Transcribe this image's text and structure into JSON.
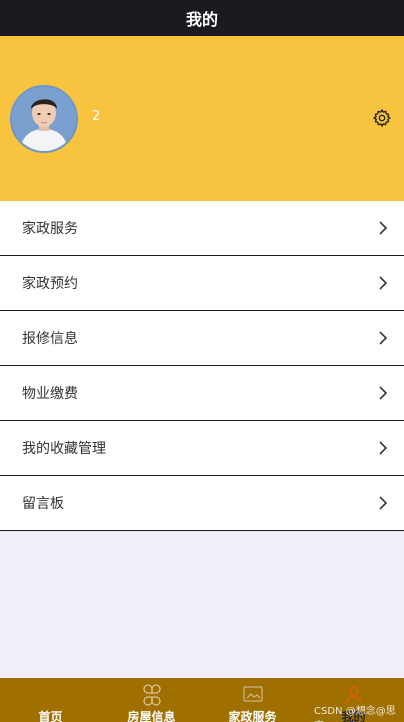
{
  "header": {
    "title": "我的"
  },
  "profile": {
    "username": "2",
    "avatar_icon": "user-photo",
    "settings_icon": "gear-icon"
  },
  "menu": [
    {
      "label": "家政服务",
      "icon": "chevron-right-icon"
    },
    {
      "label": "家政预约",
      "icon": "chevron-right-icon"
    },
    {
      "label": "报修信息",
      "icon": "chevron-right-icon"
    },
    {
      "label": "物业缴费",
      "icon": "chevron-right-icon"
    },
    {
      "label": "我的收藏管理",
      "icon": "chevron-right-icon"
    },
    {
      "label": "留言板",
      "icon": "chevron-right-icon"
    }
  ],
  "tabbar": {
    "tabs": [
      {
        "label": "首页",
        "icon": "home-icon"
      },
      {
        "label": "房屋信息",
        "icon": "clover-grid-icon"
      },
      {
        "label": "家政服务",
        "icon": "image-frame-icon"
      },
      {
        "label": "我的",
        "icon": "person-icon"
      }
    ],
    "active_index": 3
  },
  "watermark": "CSDN @想念@思恋",
  "colors": {
    "header_bg": "#1a1a1f",
    "profile_bg": "#f8c33e",
    "tabbar_bg": "#9f6f00",
    "page_bg": "#efeef9",
    "active_icon": "#e05a1a"
  }
}
